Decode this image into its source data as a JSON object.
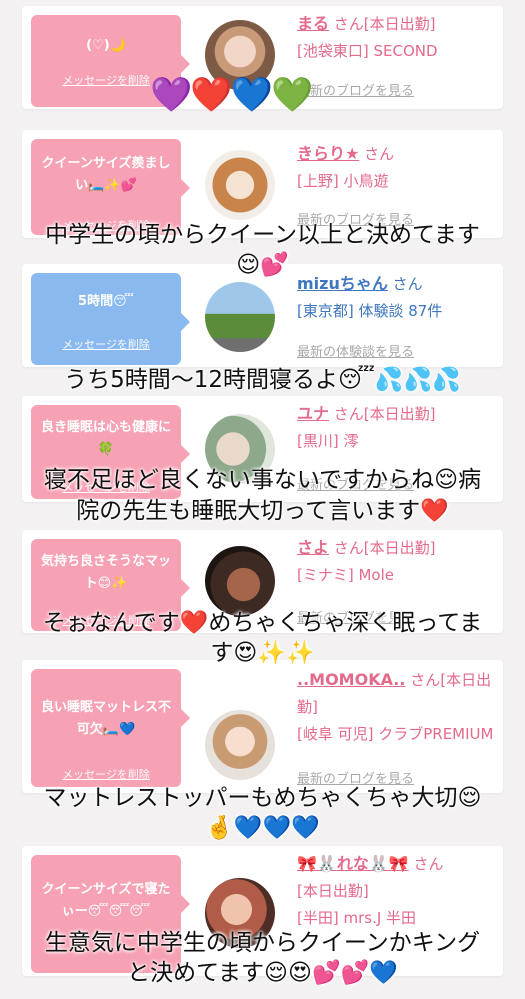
{
  "cards": [
    {
      "bubble_text": "(♡)🌙",
      "delete_label": "メッセージを削除",
      "name": "まる",
      "san": "さん[本日出勤]",
      "line2": "[池袋東口] SECOND",
      "blog": "最新のブログを見る"
    },
    {
      "bubble_text": "クイーンサイズ羨ましい🛏️✨💕",
      "delete_label": "メッセージを削除",
      "name": "きらり★",
      "san": "さん",
      "line2": "[上野] 小鳥遊",
      "blog": "最新のブログを見る"
    },
    {
      "bubble_text": "5時間😴",
      "delete_label": "メッセージを削除",
      "name": "mizuちゃん",
      "san": "さん",
      "line2": "[東京都] 体験談 87件",
      "blog": "最新の体験談を見る"
    },
    {
      "bubble_text": "良き睡眠は心も健康に🍀",
      "delete_label": "メッセージを削除",
      "name": "ユナ",
      "san": "さん[本日出勤]",
      "line2": "[黒川] 澪",
      "blog": "最新のブログを見る"
    },
    {
      "bubble_text": "気持ち良さそうなマット😊✨",
      "delete_label": "メッセージを削除",
      "name": "さよ",
      "san": "さん[本日出勤]",
      "line2": "[ミナミ] Mole",
      "blog": "最新のブログを見る"
    },
    {
      "bubble_text": "良い睡眠マットレス不可欠🛏️💙",
      "delete_label": "メッセージを削除",
      "name": "..MOMOKA..",
      "san": "さん[本日出勤]",
      "line2": "[岐阜 可児] クラブPREMIUM",
      "blog": "最新のブログを見る"
    },
    {
      "bubble_text": "クイーンサイズで寝たぃー😴😴😴",
      "delete_label": "メッセージを削除",
      "name": "🎀🐰れな🐰🎀",
      "san": "さん",
      "line2": "[本日出勤]",
      "line3": "[半田] mrs.J 半田",
      "blog": "最新のブログを見る"
    }
  ],
  "overlay_hearts": "💜❤️💙💚",
  "captions": [
    "中学生の頃からクイーン以上と決めてます",
    "😌💕",
    "うち5時間〜12時間寝るよ😴💦💦💦",
    "寝不足ほど良くない事ないですからね😌病",
    "院の先生も睡眠大切って言います❤️",
    "そぉなんです❤️めちゃくちゃ深く眠ってま",
    "す😍✨✨",
    "マットレストッパーもめちゃくちゃ大切😌",
    "🤞💙💙💙",
    "生意気に中学生の頃からクイーンかキング",
    "と決めてます😌😍💕💕💙"
  ],
  "colors": {
    "pink": "#f7a2b4",
    "blue": "#8ab9f0",
    "name_pink": "#e46a8b",
    "name_blue": "#3e77bf"
  }
}
